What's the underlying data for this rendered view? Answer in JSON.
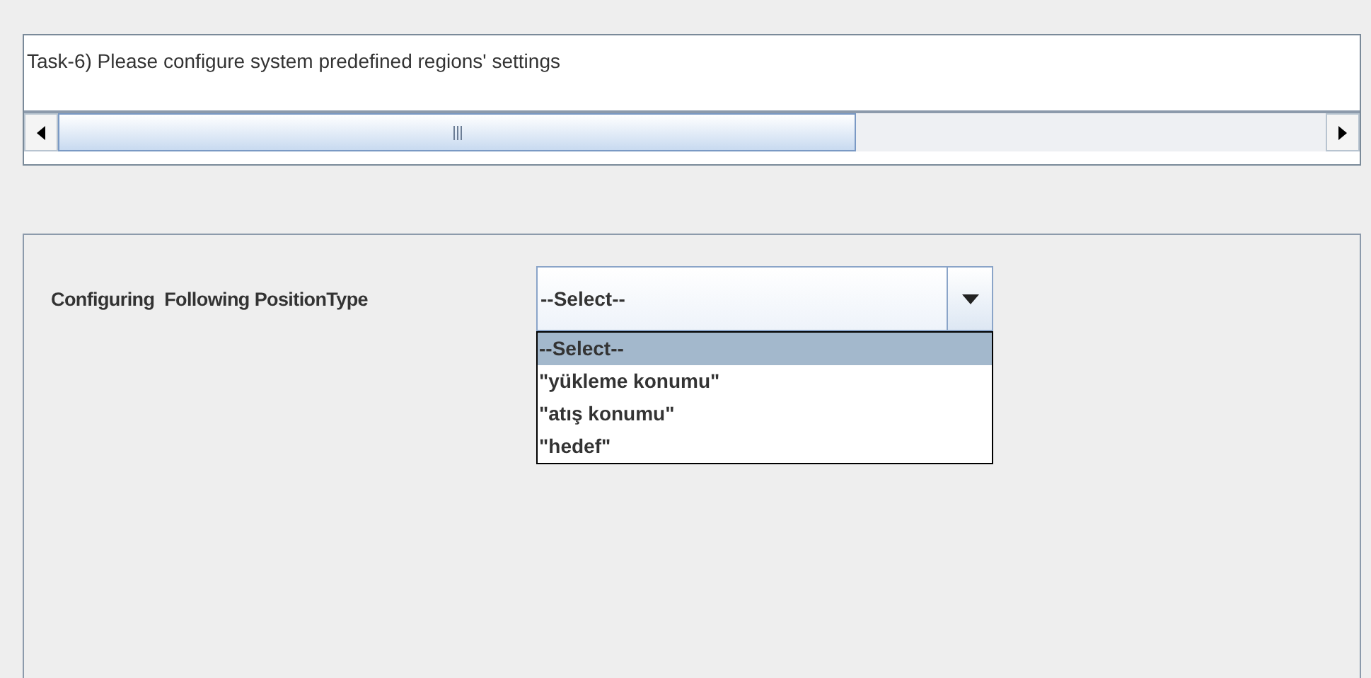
{
  "task": {
    "text": "Task-6) Please configure system predefined regions' settings"
  },
  "config": {
    "label": "Configuring  Following PositionType",
    "combo": {
      "value": "--Select--",
      "expanded": true,
      "options": [
        {
          "label": "--Select--",
          "selected": true
        },
        {
          "label": "\"yükleme konumu\"",
          "selected": false
        },
        {
          "label": "\"atış konumu\"",
          "selected": false
        },
        {
          "label": "\"hedef\"",
          "selected": false
        }
      ]
    }
  }
}
